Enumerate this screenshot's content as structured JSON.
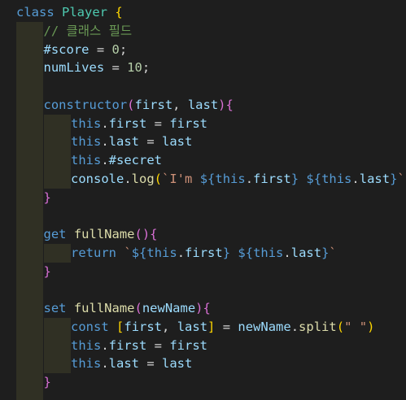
{
  "editor": {
    "language": "javascript",
    "lines": [
      {
        "indent": 0,
        "tokens": [
          [
            "class",
            "k-blue"
          ],
          [
            " ",
            "plain"
          ],
          [
            "Player",
            "k-class"
          ],
          [
            " ",
            "plain"
          ],
          [
            "{",
            "k-brace"
          ]
        ]
      },
      {
        "indent": 1,
        "tokens": [
          [
            "// 클래스 필드",
            "k-cmt"
          ]
        ]
      },
      {
        "indent": 1,
        "tokens": [
          [
            "#score",
            "k-var"
          ],
          [
            " = ",
            "plain"
          ],
          [
            "0",
            "k-num"
          ],
          [
            ";",
            "plain"
          ]
        ]
      },
      {
        "indent": 1,
        "tokens": [
          [
            "numLives",
            "k-var"
          ],
          [
            " = ",
            "plain"
          ],
          [
            "10",
            "k-num"
          ],
          [
            ";",
            "plain"
          ]
        ]
      },
      {
        "indent": 1,
        "tokens": []
      },
      {
        "indent": 1,
        "tokens": [
          [
            "constructor",
            "k-blue"
          ],
          [
            "(",
            "k-brace2"
          ],
          [
            "first",
            "k-var"
          ],
          [
            ", ",
            "plain"
          ],
          [
            "last",
            "k-var"
          ],
          [
            ")",
            "k-brace2"
          ],
          [
            "{",
            "k-brace2"
          ]
        ]
      },
      {
        "indent": 2,
        "tokens": [
          [
            "this",
            "k-blue"
          ],
          [
            ".",
            "plain"
          ],
          [
            "first",
            "k-var"
          ],
          [
            " = ",
            "plain"
          ],
          [
            "first",
            "k-var"
          ]
        ]
      },
      {
        "indent": 2,
        "tokens": [
          [
            "this",
            "k-blue"
          ],
          [
            ".",
            "plain"
          ],
          [
            "last",
            "k-var"
          ],
          [
            " = ",
            "plain"
          ],
          [
            "last",
            "k-var"
          ]
        ]
      },
      {
        "indent": 2,
        "tokens": [
          [
            "this",
            "k-blue"
          ],
          [
            ".",
            "plain"
          ],
          [
            "#secret",
            "k-var"
          ]
        ]
      },
      {
        "indent": 2,
        "tokens": [
          [
            "console",
            "k-var"
          ],
          [
            ".",
            "plain"
          ],
          [
            "log",
            "k-func"
          ],
          [
            "(",
            "k-brace"
          ],
          [
            "`I'm ",
            "k-str"
          ],
          [
            "${",
            "k-tmpl"
          ],
          [
            "this",
            "k-blue"
          ],
          [
            ".",
            "plain"
          ],
          [
            "first",
            "k-var"
          ],
          [
            "}",
            "k-tmpl"
          ],
          [
            " ",
            "k-str"
          ],
          [
            "${",
            "k-tmpl"
          ],
          [
            "this",
            "k-blue"
          ],
          [
            ".",
            "plain"
          ],
          [
            "last",
            "k-var"
          ],
          [
            "}",
            "k-tmpl"
          ],
          [
            "`",
            "k-str"
          ],
          [
            ")",
            "k-brace"
          ]
        ]
      },
      {
        "indent": 1,
        "tokens": [
          [
            "}",
            "k-brace2"
          ]
        ]
      },
      {
        "indent": 1,
        "tokens": []
      },
      {
        "indent": 1,
        "tokens": [
          [
            "get",
            "k-blue"
          ],
          [
            " ",
            "plain"
          ],
          [
            "fullName",
            "k-func"
          ],
          [
            "()",
            "k-brace2"
          ],
          [
            "{",
            "k-brace2"
          ]
        ]
      },
      {
        "indent": 2,
        "tokens": [
          [
            "return",
            "k-blue"
          ],
          [
            " ",
            "plain"
          ],
          [
            "`",
            "k-str"
          ],
          [
            "${",
            "k-tmpl"
          ],
          [
            "this",
            "k-blue"
          ],
          [
            ".",
            "plain"
          ],
          [
            "first",
            "k-var"
          ],
          [
            "}",
            "k-tmpl"
          ],
          [
            " ",
            "k-str"
          ],
          [
            "${",
            "k-tmpl"
          ],
          [
            "this",
            "k-blue"
          ],
          [
            ".",
            "plain"
          ],
          [
            "last",
            "k-var"
          ],
          [
            "}",
            "k-tmpl"
          ],
          [
            "`",
            "k-str"
          ]
        ]
      },
      {
        "indent": 1,
        "tokens": [
          [
            "}",
            "k-brace2"
          ]
        ]
      },
      {
        "indent": 1,
        "tokens": []
      },
      {
        "indent": 1,
        "tokens": [
          [
            "set",
            "k-blue"
          ],
          [
            " ",
            "plain"
          ],
          [
            "fullName",
            "k-func"
          ],
          [
            "(",
            "k-brace2"
          ],
          [
            "newName",
            "k-var"
          ],
          [
            ")",
            "k-brace2"
          ],
          [
            "{",
            "k-brace2"
          ]
        ]
      },
      {
        "indent": 2,
        "tokens": [
          [
            "const",
            "k-blue"
          ],
          [
            " ",
            "plain"
          ],
          [
            "[",
            "k-brace"
          ],
          [
            "first",
            "k-var"
          ],
          [
            ", ",
            "plain"
          ],
          [
            "last",
            "k-var"
          ],
          [
            "]",
            "k-brace"
          ],
          [
            " = ",
            "plain"
          ],
          [
            "newName",
            "k-var"
          ],
          [
            ".",
            "plain"
          ],
          [
            "split",
            "k-func"
          ],
          [
            "(",
            "k-brace"
          ],
          [
            "\" \"",
            "k-str"
          ],
          [
            ")",
            "k-brace"
          ]
        ]
      },
      {
        "indent": 2,
        "tokens": [
          [
            "this",
            "k-blue"
          ],
          [
            ".",
            "plain"
          ],
          [
            "first",
            "k-var"
          ],
          [
            " = ",
            "plain"
          ],
          [
            "first",
            "k-var"
          ]
        ]
      },
      {
        "indent": 2,
        "tokens": [
          [
            "this",
            "k-blue"
          ],
          [
            ".",
            "plain"
          ],
          [
            "last",
            "k-var"
          ],
          [
            " = ",
            "plain"
          ],
          [
            "last",
            "k-var"
          ]
        ]
      },
      {
        "indent": 1,
        "tokens": [
          [
            "}",
            "k-brace2"
          ]
        ]
      },
      {
        "indent": 1,
        "tokens": []
      }
    ]
  },
  "colors": {
    "background": "#1e1e1e",
    "indent_guide": "#303024",
    "keyword": "#569cd6",
    "class_name": "#4ec9b0",
    "function": "#dcdcaa",
    "variable": "#9cdcfe",
    "number": "#b5cea8",
    "string": "#ce9178",
    "comment": "#6a9955",
    "bracket_gold": "#ffd700",
    "bracket_purple": "#da70d6"
  }
}
